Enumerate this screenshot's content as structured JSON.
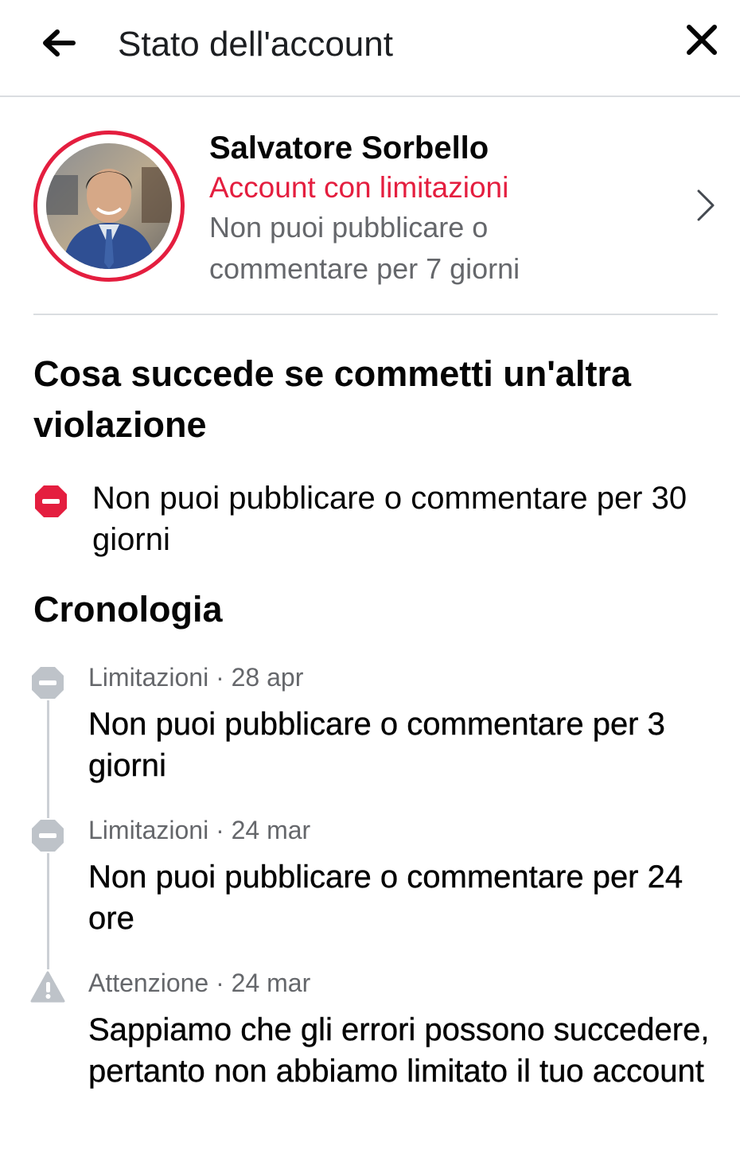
{
  "header": {
    "title": "Stato dell'account",
    "back_icon": "arrow-left-icon",
    "close_icon": "close-icon"
  },
  "profile": {
    "name": "Salvatore Sorbello",
    "status": "Account con limitazioni",
    "description": "Non puoi pubblicare o commentare per 7 giorni",
    "status_color": "#e41e3f"
  },
  "next_violation": {
    "title": "Cosa succede se commetti un'altra violazione",
    "item_text": "Non puoi pubblicare o commentare per 30 giorni",
    "icon": "stop-icon"
  },
  "history": {
    "title": "Cronologia",
    "items": [
      {
        "type": "Limitazioni",
        "date": "28 apr",
        "meta": "Limitazioni · 28 apr",
        "text": "Non puoi pubblicare o commentare per 3 giorni",
        "icon": "restriction-icon"
      },
      {
        "type": "Limitazioni",
        "date": "24 mar",
        "meta": "Limitazioni · 24 mar",
        "text": "Non puoi pubblicare o commentare per 24 ore",
        "icon": "restriction-icon"
      },
      {
        "type": "Attenzione",
        "date": "24 mar",
        "meta": "Attenzione · 24 mar",
        "text": "Sappiamo che gli errori possono succedere, pertanto non abbiamo limitato il tuo account",
        "icon": "warning-icon"
      }
    ]
  },
  "colors": {
    "accent_red": "#e41e3f",
    "secondary_text": "#65676b",
    "timeline_gray": "#bec3c9"
  }
}
